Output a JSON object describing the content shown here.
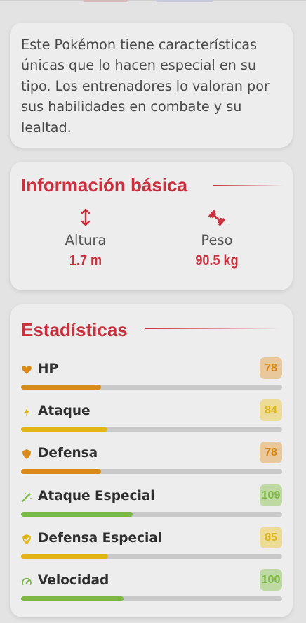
{
  "description": "Este Pokémon tiene características únicas que lo hacen especial en su tipo. Los entrenadores lo valoran por sus habilidades en combate y su lealtad.",
  "basic_info": {
    "title": "Información básica",
    "height_label": "Altura",
    "height_value": "1.7 m",
    "weight_label": "Peso",
    "weight_value": "90.5 kg"
  },
  "stats": {
    "title": "Estadísticas",
    "max_value": 255,
    "items": [
      {
        "name": "HP",
        "value": "78",
        "icon": "heart-icon",
        "color": "#d98a18",
        "badge_bg": "#e9c89b"
      },
      {
        "name": "Ataque",
        "value": "84",
        "icon": "bolt-icon",
        "color": "#e0b515",
        "badge_bg": "#ecdc98"
      },
      {
        "name": "Defensa",
        "value": "78",
        "icon": "shield-icon",
        "color": "#d98a18",
        "badge_bg": "#e9c89b"
      },
      {
        "name": "Ataque Especial",
        "value": "109",
        "icon": "magic-wand-icon",
        "color": "#7bb845",
        "badge_bg": "#bfd9a4"
      },
      {
        "name": "Defensa Especial",
        "value": "85",
        "icon": "shield-check-icon",
        "color": "#e0b515",
        "badge_bg": "#ecdc98"
      },
      {
        "name": "Velocidad",
        "value": "100",
        "icon": "gauge-icon",
        "color": "#7bb845",
        "badge_bg": "#bfd9a4"
      }
    ]
  },
  "colors": {
    "accent": "#c9303d",
    "background": "#e3e3e3",
    "card": "#ededed",
    "track": "#c9c9c9"
  }
}
